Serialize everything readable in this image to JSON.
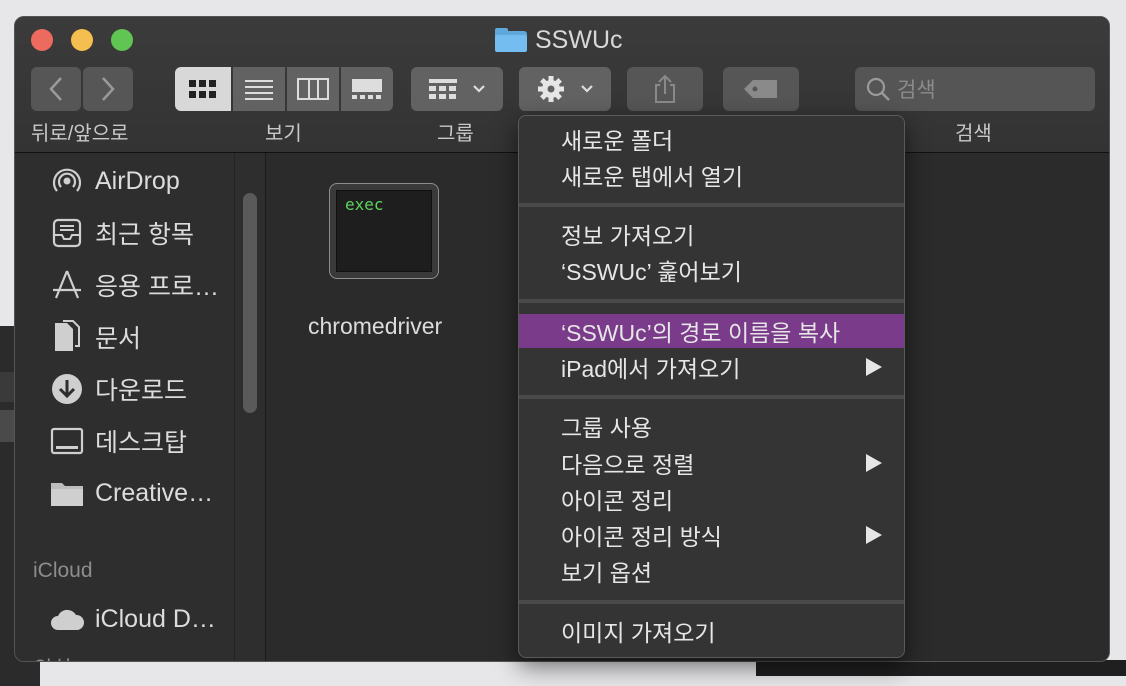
{
  "window": {
    "title": "SSWUc"
  },
  "toolbar": {
    "back_forward_label": "뒤로/앞으로",
    "view_label": "보기",
    "group_label": "그룹",
    "search_label": "검색",
    "search_placeholder": "검색"
  },
  "sidebar": {
    "items": [
      {
        "label": "AirDrop",
        "icon": "airdrop-icon"
      },
      {
        "label": "최근 항목",
        "icon": "recents-icon"
      },
      {
        "label": "응용 프로…",
        "icon": "applications-icon"
      },
      {
        "label": "문서",
        "icon": "document-icon"
      },
      {
        "label": "다운로드",
        "icon": "download-icon"
      },
      {
        "label": "데스크탑",
        "icon": "desktop-icon"
      },
      {
        "label": "Creative…",
        "icon": "folder-icon"
      }
    ],
    "icloud_section": "iCloud",
    "icloud_items": [
      {
        "label": "iCloud D…",
        "icon": "cloud-icon"
      }
    ],
    "locations_section": "위치"
  },
  "content": {
    "file": {
      "name": "chromedriver",
      "icon_text": "exec"
    }
  },
  "context_menu": {
    "items": [
      {
        "label": "새로운 폴더"
      },
      {
        "label": "새로운 탭에서 열기"
      },
      {
        "label": "정보 가져오기"
      },
      {
        "label": "‘SSWUc’ 훑어보기"
      },
      {
        "label": "‘SSWUc’의 경로 이름을 복사"
      },
      {
        "label": "iPad에서 가져오기"
      },
      {
        "label": "그룹 사용"
      },
      {
        "label": "다음으로 정렬"
      },
      {
        "label": "아이콘 정리"
      },
      {
        "label": "아이콘 정리 방식"
      },
      {
        "label": "보기 옵션"
      },
      {
        "label": "이미지 가져오기"
      }
    ]
  },
  "colors": {
    "highlight": "#7a3b8a",
    "window_bg": "#2b2b2b",
    "folder_blue": "#74bdf0"
  }
}
